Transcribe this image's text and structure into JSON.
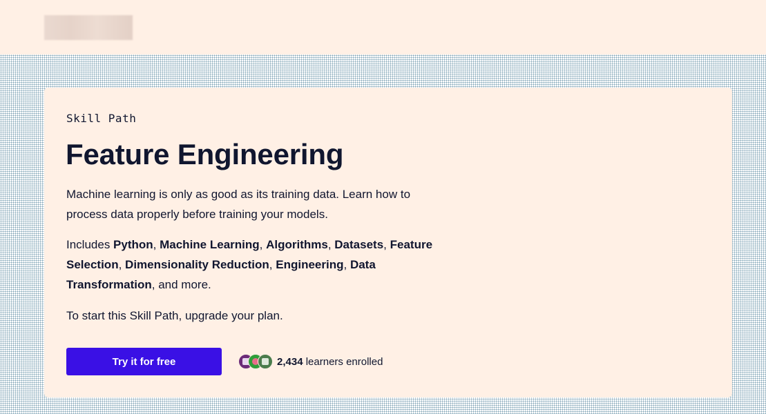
{
  "card": {
    "eyebrow": "Skill Path",
    "title": "Feature Engineering",
    "description": "Machine learning is only as good as its training data. Learn how to process data properly before training your models.",
    "includes_prefix": "Includes ",
    "includes_items": [
      "Python",
      "Machine Learning",
      "Algorithms",
      "Datasets",
      "Feature Selection",
      "Dimensionality Reduction",
      "Engineering",
      "Data Transformation"
    ],
    "includes_suffix": " and more.",
    "upgrade_text": "To start this Skill Path, upgrade your plan.",
    "cta_label": "Try it for free",
    "learners_count": "2,434",
    "learners_label": " learners enrolled"
  },
  "colors": {
    "page_bg": "#fff0e5",
    "text": "#10162f",
    "cta_bg": "#3a10e5",
    "cta_text": "#ffffff"
  }
}
